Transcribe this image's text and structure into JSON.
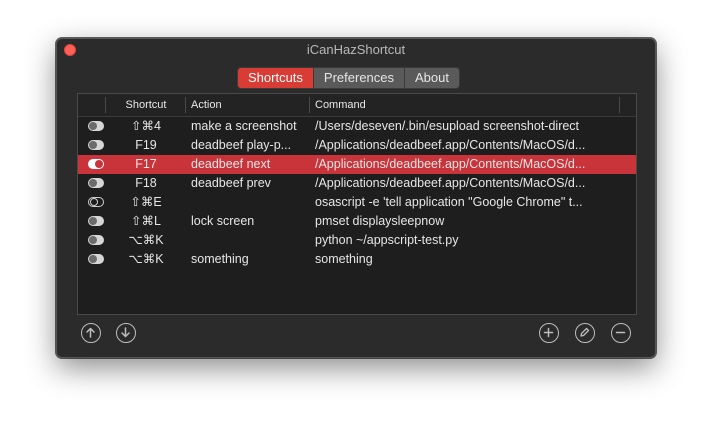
{
  "window": {
    "title": "iCanHazShortcut"
  },
  "tabs": [
    {
      "label": "Shortcuts",
      "active": true
    },
    {
      "label": "Preferences",
      "active": false
    },
    {
      "label": "About",
      "active": false
    }
  ],
  "table": {
    "columns": [
      "",
      "Shortcut",
      "Action",
      "Command"
    ],
    "rows": [
      {
        "enabled": true,
        "shortcut": "⇧⌘4",
        "action": "make a screenshot",
        "command": "/Users/deseven/.bin/esupload screenshot-direct",
        "selected": false
      },
      {
        "enabled": true,
        "shortcut": "F19",
        "action": "deadbeef play-p...",
        "command": "/Applications/deadbeef.app/Contents/MacOS/d...",
        "selected": false
      },
      {
        "enabled": true,
        "shortcut": "F17",
        "action": "deadbeef next",
        "command": "/Applications/deadbeef.app/Contents/MacOS/d...",
        "selected": true
      },
      {
        "enabled": true,
        "shortcut": "F18",
        "action": "deadbeef prev",
        "command": "/Applications/deadbeef.app/Contents/MacOS/d...",
        "selected": false
      },
      {
        "enabled": false,
        "shortcut": "⇧⌘E",
        "action": "",
        "command": "osascript -e 'tell application \"Google Chrome\" t...",
        "selected": false
      },
      {
        "enabled": true,
        "shortcut": "⇧⌘L",
        "action": "lock screen",
        "command": "pmset displaysleepnow",
        "selected": false
      },
      {
        "enabled": true,
        "shortcut": "⌥⌘K",
        "action": "",
        "command": "python ~/appscript-test.py",
        "selected": false
      },
      {
        "enabled": true,
        "shortcut": "⌥⌘K",
        "action": "something",
        "command": "something",
        "selected": false
      }
    ]
  },
  "toolbar": {
    "move_up": "arrow-up-icon",
    "move_down": "arrow-down-icon",
    "add": "plus-icon",
    "edit": "pencil-icon",
    "remove": "minus-icon"
  },
  "colors": {
    "accent": "#d93b35",
    "window_bg": "#2b2b2b",
    "table_bg": "#1e1e1e"
  }
}
